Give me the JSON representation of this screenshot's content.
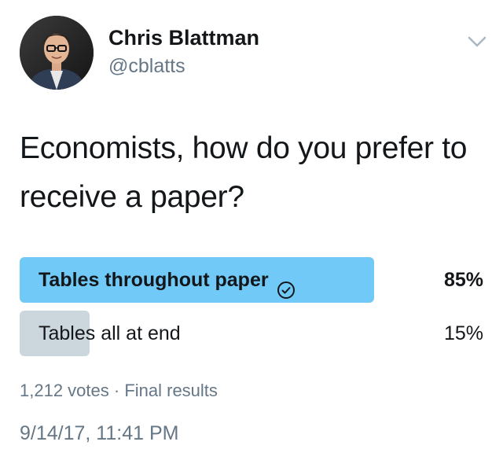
{
  "author": {
    "display_name": "Chris Blattman",
    "handle": "@cblatts",
    "avatar_icon": "profile-photo"
  },
  "tweet": {
    "text": "Economists, how do you prefer to receive a paper?",
    "timestamp": "9/14/17, 11:41 PM"
  },
  "poll": {
    "options": [
      {
        "label": "Tables throughout paper",
        "percent_text": "85%",
        "percent": 85,
        "winner": true
      },
      {
        "label": "Tables all at end",
        "percent_text": "15%",
        "percent": 15,
        "winner": false
      }
    ],
    "votes_text": "1,212 votes",
    "separator": "·",
    "status_text": "Final results"
  },
  "colors": {
    "winner_bar": "#71c9f8",
    "other_bar": "#ccd6dd",
    "text_primary": "#14171a",
    "text_secondary": "#657786"
  },
  "icons": {
    "menu": "chevron-down-icon",
    "winner_marker": "check-circle-icon"
  }
}
